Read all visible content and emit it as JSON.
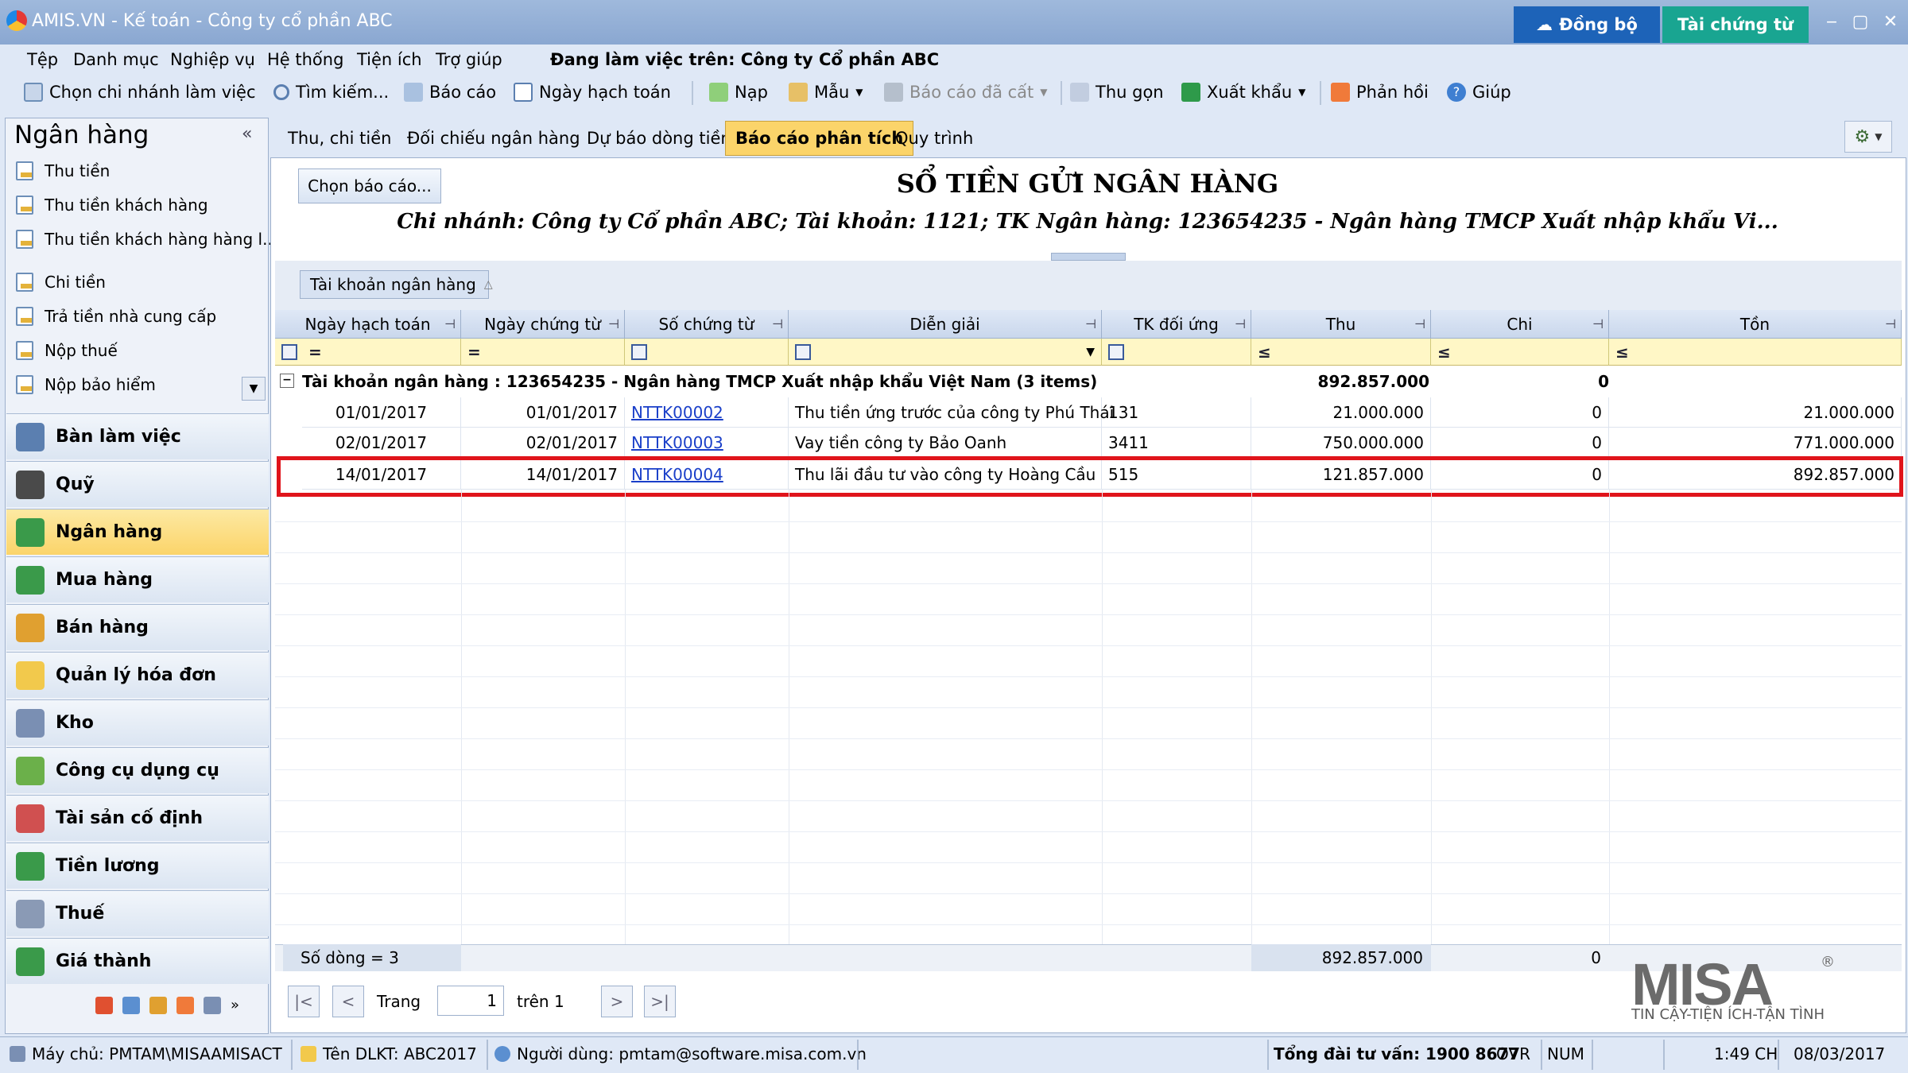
{
  "window": {
    "title": "AMIS.VN - Kế toán - Công ty cổ phần ABC",
    "sync_label": "Đồng bộ",
    "docs_label": "Tài chứng từ",
    "minimize": "‒",
    "maximize": "▢",
    "close": "✕"
  },
  "menu": {
    "items": [
      "Tệp",
      "Danh mục",
      "Nghiệp vụ",
      "Hệ thống",
      "Tiện ích",
      "Trợ giúp"
    ],
    "working_on": "Đang làm việc trên: Công ty Cổ phần ABC"
  },
  "toolbar": {
    "branch": "Chọn chi nhánh làm việc",
    "search": "Tìm kiếm...",
    "report": "Báo cáo",
    "posting_date": "Ngày hạch toán",
    "load": "Nạp",
    "template": "Mẫu",
    "saved_reports": "Báo cáo đã cất",
    "collapse": "Thu gọn",
    "export": "Xuất khẩu",
    "feedback": "Phản hồi",
    "help": "Giúp"
  },
  "sidebar": {
    "title": "Ngân hàng",
    "links": [
      "Thu tiền",
      "Thu tiền khách hàng",
      "Thu tiền khách hàng hàng l...",
      "Chi tiền",
      "Trả tiền nhà cung cấp",
      "Nộp thuế",
      "Nộp bảo hiểm"
    ],
    "modules": [
      "Bàn làm việc",
      "Quỹ",
      "Ngân hàng",
      "Mua hàng",
      "Bán hàng",
      "Quản lý hóa đơn",
      "Kho",
      "Công cụ dụng cụ",
      "Tài sản cố định",
      "Tiền lương",
      "Thuế",
      "Giá thành"
    ],
    "active_module": "Ngân hàng"
  },
  "tabs": [
    "Thu, chi tiền",
    "Đối chiếu ngân hàng",
    "Dự báo dòng tiền",
    "Báo cáo phân tích",
    "Quy trình"
  ],
  "active_tab": "Báo cáo phân tích",
  "report": {
    "choose_label": "Chọn báo cáo...",
    "title": "SỔ TIỀN GỬI NGÂN HÀNG",
    "subtitle": "Chi nhánh: Công ty Cổ phần ABC; Tài khoản: 1121; TK Ngân hàng: 123654235 - Ngân hàng TMCP Xuất nhập khẩu Vi...",
    "group_chip": "Tài khoản ngân hàng",
    "columns": [
      "Ngày hạch toán",
      "Ngày chứng từ",
      "Số chứng từ",
      "Diễn giải",
      "TK đối ứng",
      "Thu",
      "Chi",
      "Tồn"
    ],
    "filter_ops": [
      "=",
      "=",
      "≤",
      "≤",
      "≤"
    ],
    "group": {
      "label": "Tài khoản ngân hàng : 123654235 - Ngân hàng TMCP Xuất nhập khẩu Việt Nam (3 items)",
      "thu": "892.857.000",
      "chi": "0"
    },
    "rows": [
      {
        "posting_date": "01/01/2017",
        "doc_date": "01/01/2017",
        "doc_no": "NTTK00002",
        "desc": "Thu tiền ứng trước của công ty Phú Thái",
        "account": "131",
        "thu": "21.000.000",
        "chi": "0",
        "ton": "21.000.000"
      },
      {
        "posting_date": "02/01/2017",
        "doc_date": "02/01/2017",
        "doc_no": "NTTK00003",
        "desc": "Vay tiền công ty Bảo Oanh",
        "account": "3411",
        "thu": "750.000.000",
        "chi": "0",
        "ton": "771.000.000"
      },
      {
        "posting_date": "14/01/2017",
        "doc_date": "14/01/2017",
        "doc_no": "NTTK00004",
        "desc": "Thu lãi đầu tư vào công ty Hoàng Cầu",
        "account": "515",
        "thu": "121.857.000",
        "chi": "0",
        "ton": "892.857.000"
      }
    ],
    "highlighted_row": 3,
    "footer": {
      "row_count": "Số dòng = 3",
      "thu": "892.857.000",
      "chi": "0"
    },
    "pager": {
      "page_label": "Trang",
      "page": "1",
      "of_label": "trên 1"
    }
  },
  "brand": {
    "logo": "MISA",
    "reg": "®",
    "tagline": "TIN CẬY-TIỆN ÍCH-TẬN TÌNH"
  },
  "status": {
    "server": "Máy chủ: PMTAM\\MISAAMISACT",
    "db": "Tên DLKT: ABC2017",
    "user": "Người dùng: pmtam@software.misa.com.vn",
    "hotline": "Tổng đài tư vấn: 1900 8677",
    "ovr": "OVR",
    "num": "NUM",
    "time": "1:49 CH",
    "date": "08/03/2017"
  },
  "colors": {
    "accent": "#fbd46a",
    "highlight": "#e0141b",
    "link": "#1a3fc9",
    "sync": "#1d63b8",
    "docs": "#19a591"
  }
}
